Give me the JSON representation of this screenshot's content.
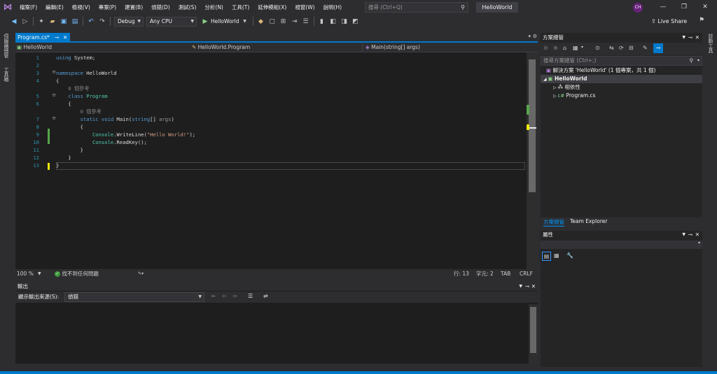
{
  "menubar": {
    "items": [
      "檔案(F)",
      "編輯(E)",
      "檢視(V)",
      "專案(P)",
      "建置(B)",
      "偵錯(D)",
      "測試(S)",
      "分析(N)",
      "工具(T)",
      "延伸模組(X)",
      "視窗(W)",
      "說明(H)"
    ],
    "search_placeholder": "搜尋 (Ctrl+Q)",
    "solution_title": "HelloWorld",
    "avatar_initials": "CH"
  },
  "toolbar": {
    "config": "Debug",
    "platform": "Any CPU",
    "run_label": "HelloWorld",
    "liveshare": "Live Share"
  },
  "left_strip": {
    "items": [
      "伺服器總管",
      "工具箱"
    ]
  },
  "right_strip": {
    "items": [
      "診斷工具"
    ]
  },
  "document": {
    "tab_label": "Program.cs*",
    "nav_project": "HelloWorld",
    "nav_class": "HelloWorld.Program",
    "nav_member": "Main(string[] args)"
  },
  "code": {
    "lines": [
      {
        "n": "1",
        "segments": [
          {
            "t": "using ",
            "c": "kw"
          },
          {
            "t": "System;",
            "c": ""
          }
        ]
      },
      {
        "n": "2",
        "segments": []
      },
      {
        "n": "3",
        "segments": [
          {
            "t": "namespace ",
            "c": "kw"
          },
          {
            "t": "HelloWorld",
            "c": ""
          }
        ]
      },
      {
        "n": "4",
        "segments": [
          {
            "t": "{",
            "c": ""
          }
        ]
      },
      {
        "n": "",
        "segments": [
          {
            "t": "    0 個參考",
            "c": "dim"
          }
        ]
      },
      {
        "n": "5",
        "segments": [
          {
            "t": "    class ",
            "c": "kw"
          },
          {
            "t": "Program",
            "c": "ty"
          }
        ]
      },
      {
        "n": "6",
        "segments": [
          {
            "t": "    {",
            "c": ""
          }
        ]
      },
      {
        "n": "",
        "segments": [
          {
            "t": "        0 個參考",
            "c": "dim"
          }
        ]
      },
      {
        "n": "7",
        "segments": [
          {
            "t": "        static void ",
            "c": "kw"
          },
          {
            "t": "Main(",
            "c": ""
          },
          {
            "t": "string",
            "c": "kw"
          },
          {
            "t": "[] ",
            "c": ""
          },
          {
            "t": "args",
            "c": "gray"
          },
          {
            "t": ")",
            "c": ""
          }
        ]
      },
      {
        "n": "8",
        "segments": [
          {
            "t": "        {",
            "c": ""
          }
        ]
      },
      {
        "n": "9",
        "segments": [
          {
            "t": "            ",
            "c": ""
          },
          {
            "t": "Console",
            "c": "ty"
          },
          {
            "t": ".WriteLine(",
            "c": ""
          },
          {
            "t": "\"Hello World!\"",
            "c": "st"
          },
          {
            "t": ");",
            "c": ""
          }
        ]
      },
      {
        "n": "10",
        "segments": [
          {
            "t": "            ",
            "c": ""
          },
          {
            "t": "Console",
            "c": "ty"
          },
          {
            "t": ".ReadKey();",
            "c": ""
          }
        ]
      },
      {
        "n": "11",
        "segments": [
          {
            "t": "        }",
            "c": ""
          }
        ]
      },
      {
        "n": "12",
        "segments": [
          {
            "t": "    }",
            "c": ""
          }
        ]
      },
      {
        "n": "13",
        "segments": [
          {
            "t": "}",
            "c": ""
          }
        ]
      }
    ]
  },
  "status": {
    "zoom": "100 %",
    "issues": "找不到任何問題",
    "line": "行: 13",
    "char": "字元: 2",
    "tab": "TAB",
    "eol": "CRLF"
  },
  "output": {
    "title": "輸出",
    "source_label": "顯示輸出來源(S):",
    "source_value": "偵錯"
  },
  "solution_explorer": {
    "title": "方案總管",
    "search_placeholder": "搜尋方案總管 (Ctrl+;)",
    "solution_node": "解決方案 'HelloWorld' (1 個專案，共 1 個)",
    "project_node": "HelloWorld",
    "deps_node": "相依性",
    "file_node": "Program.cs",
    "tabs": [
      "方案總管",
      "Team Explorer"
    ]
  },
  "properties": {
    "title": "屬性"
  }
}
